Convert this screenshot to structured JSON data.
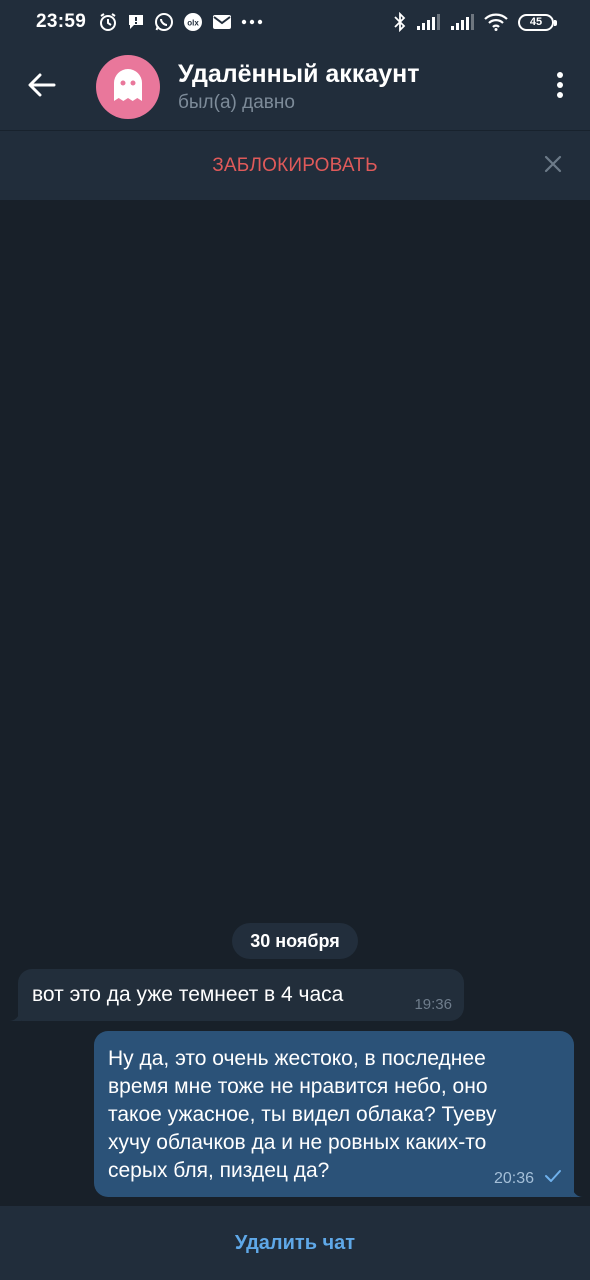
{
  "status_bar": {
    "time": "23:59",
    "left_icons": [
      "alarm-icon",
      "message-notification-icon",
      "whatsapp-icon",
      "olx-icon",
      "mail-icon",
      "more-dots-icon"
    ],
    "right_icons": [
      "bluetooth-icon",
      "signal-icon",
      "signal-icon",
      "wifi-icon",
      "battery-icon"
    ],
    "battery": "45"
  },
  "header": {
    "title": "Удалённый аккаунт",
    "subtitle": "был(а) давно",
    "avatar_color": "#e9779b",
    "back_icon": "arrow-left-icon",
    "menu_icon": "kebab-menu-icon"
  },
  "block_bar": {
    "label": "ЗАБЛОКИРОВАТЬ",
    "label_color": "#e05a5a",
    "close_icon": "close-icon"
  },
  "chat": {
    "date": "30 ноября",
    "messages": [
      {
        "direction": "incoming",
        "text": "вот это да уже темнеет в  4 часа",
        "time": "19:36"
      },
      {
        "direction": "outgoing",
        "lines": [
          "Ну да, это очень жестоко, в последнее",
          "время мне тоже не нравится небо, оно",
          "такое ужасное, ты видел облака? Туеву",
          "хучу облачков да и не ровных каких-то",
          "серых бля, пиздец да?"
        ],
        "time": "20:36",
        "status_icon": "check-icon"
      }
    ]
  },
  "bottom": {
    "delete_label": "Удалить чат",
    "accent": "#5fa8e8"
  },
  "colors": {
    "background": "#182029",
    "header": "#212d3b",
    "bubble_in": "#222e3b",
    "bubble_out": "#2b5278"
  }
}
